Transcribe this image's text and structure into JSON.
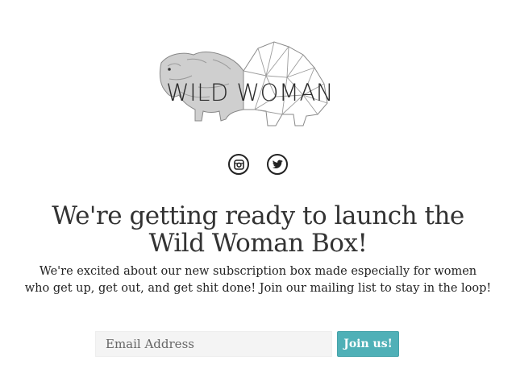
{
  "logo": {
    "text": "WILD WOMAN",
    "icon": "bear-geometric-logo"
  },
  "social": [
    {
      "name": "instagram",
      "icon": "instagram-icon"
    },
    {
      "name": "twitter",
      "icon": "twitter-icon"
    }
  ],
  "headline": {
    "line1": "We're getting ready to launch the",
    "line2": "Wild Woman Box!"
  },
  "description": {
    "line1": "We're excited about our new subscription box made especially for women",
    "line2": "who get up, get out, and get shit done! Join our mailing list to stay in the loop!"
  },
  "form": {
    "email_placeholder": "Email Address",
    "email_value": "",
    "submit_label": "Join us!"
  },
  "colors": {
    "accent": "#4fb0b7",
    "text": "#333333",
    "input_bg": "#f4f4f4"
  }
}
